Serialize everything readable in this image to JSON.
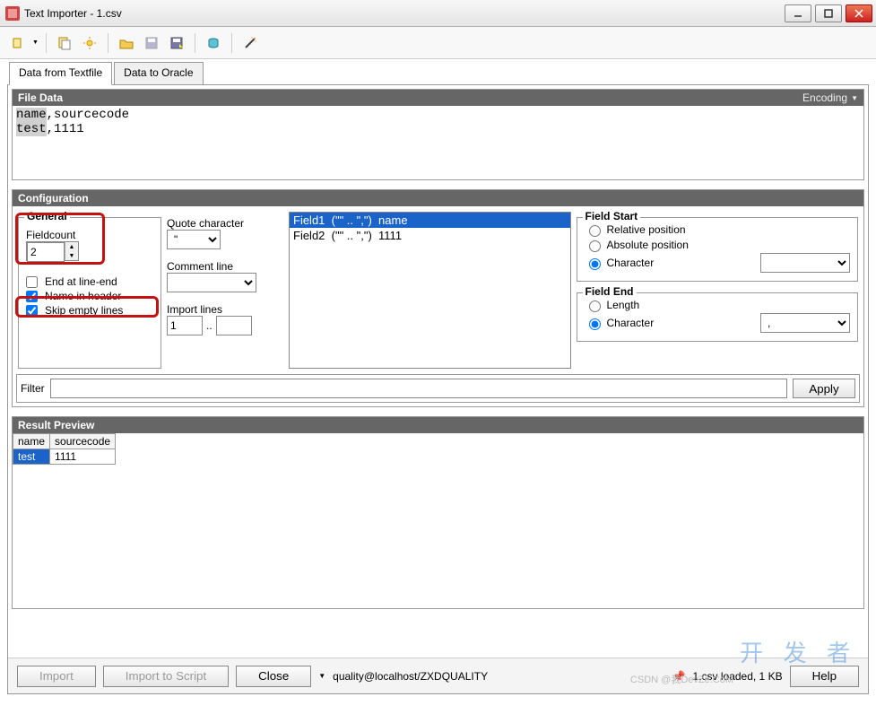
{
  "window": {
    "title": "Text Importer - 1.csv"
  },
  "tabs": {
    "active": "Data from Textfile",
    "other": "Data to Oracle"
  },
  "file_data": {
    "header_label": "File Data",
    "encoding_label": "Encoding",
    "content_line1_a": "name",
    "content_line1_b": ",sourcecode",
    "content_line2_a": "test",
    "content_line2_b": ",1111"
  },
  "config": {
    "header_label": "Configuration",
    "general_label": "General",
    "fieldcount_label": "Fieldcount",
    "fieldcount_value": "2",
    "end_at_line_end_label": "End at line-end",
    "name_in_header_label": "Name in header",
    "skip_empty_label": "Skip empty lines",
    "end_at_line_end_checked": false,
    "name_in_header_checked": true,
    "skip_empty_checked": true,
    "quote_char_label": "Quote character",
    "quote_char_value": "\"",
    "comment_line_label": "Comment line",
    "comment_line_value": "",
    "import_lines_label": "Import lines",
    "import_lines_from": "1",
    "import_lines_sep": "..",
    "import_lines_to": ""
  },
  "fields": [
    {
      "label": "Field1  (\"\" .. \",\")  name",
      "selected": true
    },
    {
      "label": "Field2  (\"\" .. \",\")  1111",
      "selected": false
    }
  ],
  "fieldstart": {
    "label": "Field Start",
    "options": {
      "relative": "Relative position",
      "absolute": "Absolute position",
      "character": "Character"
    },
    "selected": "character",
    "value": ""
  },
  "fieldend": {
    "label": "Field End",
    "options": {
      "length": "Length",
      "character": "Character"
    },
    "selected": "character",
    "value": ","
  },
  "filter": {
    "label": "Filter",
    "value": "",
    "apply_label": "Apply"
  },
  "result": {
    "header_label": "Result Preview",
    "columns": [
      "name",
      "sourcecode"
    ],
    "rows": [
      {
        "name": "test",
        "sourcecode": "1111"
      }
    ]
  },
  "footer": {
    "import_label": "Import",
    "import_script_label": "Import to Script",
    "close_label": "Close",
    "connection": "quality@localhost/ZXDQUALITY",
    "status": "1.csv loaded, 1 KB",
    "help_label": "Help"
  },
  "watermark_text": "开 发 者",
  "csdn_text": "CSDN @我DevZe.CoM"
}
